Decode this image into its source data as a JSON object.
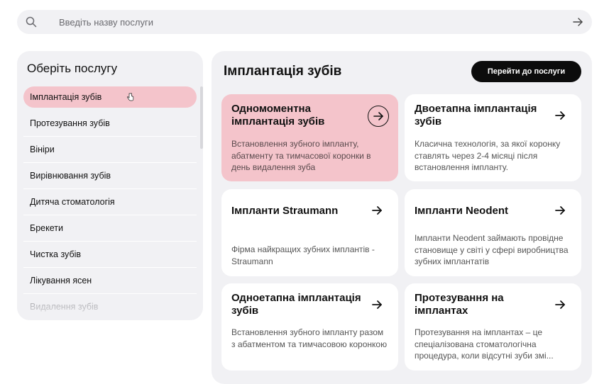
{
  "search": {
    "placeholder": "Введіть назву послуги"
  },
  "sidebar": {
    "title": "Оберіть послугу",
    "items": [
      {
        "label": "Імплантація зубів"
      },
      {
        "label": "Протезування зубів"
      },
      {
        "label": "Вініри"
      },
      {
        "label": "Вирівнювання зубів"
      },
      {
        "label": "Дитяча стоматологія"
      },
      {
        "label": "Брекети"
      },
      {
        "label": "Чистка зубів"
      },
      {
        "label": "Лікування ясен"
      },
      {
        "label": "Видалення зубів"
      }
    ]
  },
  "main": {
    "title": "Імплантація зубів",
    "cta_label": "Перейти до послуги",
    "cards": [
      {
        "title": "Одномоментна імплантація зубів",
        "desc": "Встановлення зубного імпланту, абатменту та тимчасової коронки в день видалення зуба"
      },
      {
        "title": "Двоетапна імплантація зубів",
        "desc": "Класична технологія, за якої коронку ставлять через 2-4 місяці після встановлення імпланту."
      },
      {
        "title": "Імпланти Straumann",
        "desc": "Фірма найкращих зубних імплантів - Straumann"
      },
      {
        "title": "Імпланти Neodent",
        "desc": "Імпланти Neodent займають провідне становище у світі у сфері виробництва зубних імплантатів"
      },
      {
        "title": "Одноетапна імплантація зубів",
        "desc": "Встановлення зубного імпланту разом з абатментом та тимчасовою коронкою"
      },
      {
        "title": "Протезування на імплантах",
        "desc": "Протезування на імплантах – це спеціалізована стоматологічна процедура, коли відсутні зуби змі..."
      }
    ]
  },
  "colors": {
    "accent": "#f4c4cb",
    "panel": "#f1f1f4",
    "button": "#0c0c0c"
  }
}
